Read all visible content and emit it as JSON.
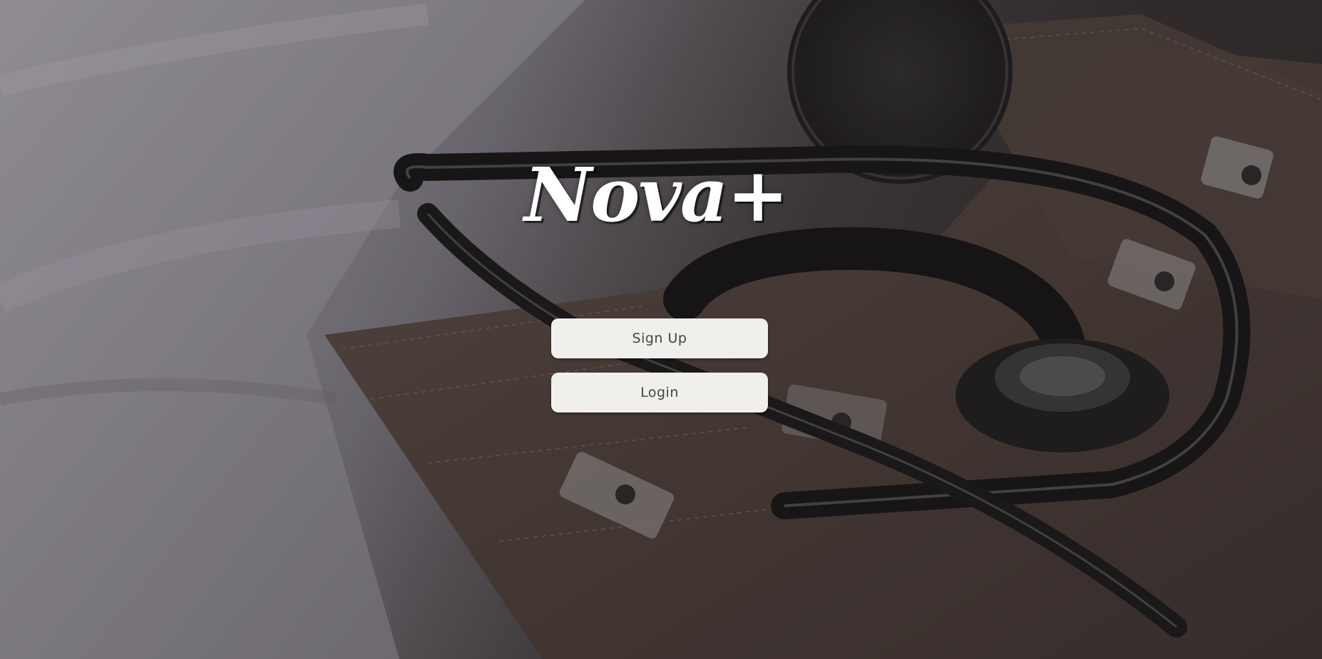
{
  "app": {
    "logo_text": "Nova+"
  },
  "actions": {
    "signup_label": "Sign Up",
    "login_label": "Login"
  },
  "background": {
    "description_icon": "stethoscope-photo",
    "tint_color": "#2a2626"
  },
  "colors": {
    "button_bg": "#f1efec",
    "button_text": "#444444",
    "logo_text": "#ffffff"
  }
}
